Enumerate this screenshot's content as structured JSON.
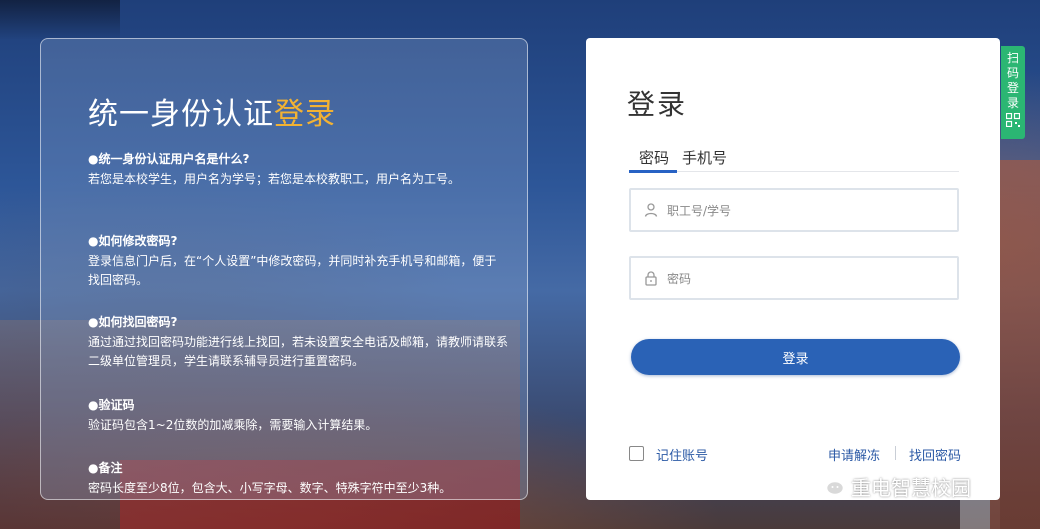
{
  "info_panel": {
    "title_main": "统一身份认证",
    "title_highlight": "登录",
    "faqs": [
      {
        "question": "●统一身份认证用户名是什么?",
        "answer": "若您是本校学生，用户名为学号；若您是本校教职工，用户名为工号。"
      },
      {
        "question": "●如何修改密码?",
        "answer": "登录信息门户后，在“个人设置”中修改密码，并同时补充手机号和邮箱，便于找回密码。"
      },
      {
        "question": "●如何找回密码?",
        "answer": "通过通过找回密码功能进行线上找回，若未设置安全电话及邮箱，请教师请联系二级单位管理员，学生请联系辅导员进行重置密码。"
      },
      {
        "question": "●验证码",
        "answer": "验证码包含1~2位数的加减乘除，需要输入计算结果。"
      },
      {
        "question": "●备注",
        "answer": "密码长度至少8位，包含大、小写字母、数字、特殊字符中至少3种。"
      }
    ]
  },
  "login": {
    "title": "登录",
    "tabs": [
      {
        "label": "密码",
        "active": true
      },
      {
        "label": "手机号",
        "active": false
      }
    ],
    "username": {
      "value": "",
      "placeholder": "职工号/学号",
      "icon": "user-icon"
    },
    "password": {
      "value": "",
      "placeholder": "密码",
      "icon": "lock-icon"
    },
    "submit_label": "登录",
    "remember_label": "记住账号",
    "remember_checked": false,
    "unfreeze_label": "申请解冻",
    "forgot_label": "找回密码"
  },
  "scan_login": {
    "label": "扫码登录",
    "icon": "qr-code-icon",
    "color": "#2bb673"
  },
  "watermark": {
    "text": "重电智慧校园",
    "icon": "wechat-icon"
  },
  "colors": {
    "accent": "#2a62b6",
    "highlight": "#f2b233",
    "link": "#2c5aa6"
  }
}
